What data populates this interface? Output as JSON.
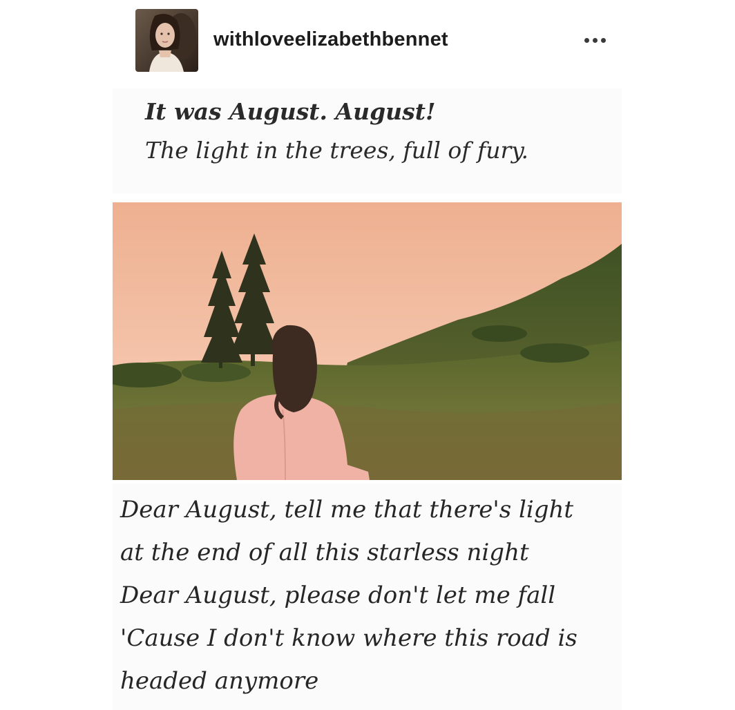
{
  "post": {
    "username": "withloveelizabethbennet",
    "more_icon": "more-horizontal-icon"
  },
  "quote": {
    "line1": "It was August. August!",
    "line2": "The light in the trees, full of fury."
  },
  "lyrics": [
    "Dear August, tell me that there's light",
    "at the end of all this starless night",
    "Dear August, please don't let me fall",
    "'Cause I don't know where this road is",
    "headed anymore"
  ],
  "colors": {
    "sky_top": "#f0b494",
    "sky_bottom": "#f6c9b2",
    "grass": "#5a6a2a",
    "sweater": "#f0b3a6",
    "text": "#262626"
  }
}
